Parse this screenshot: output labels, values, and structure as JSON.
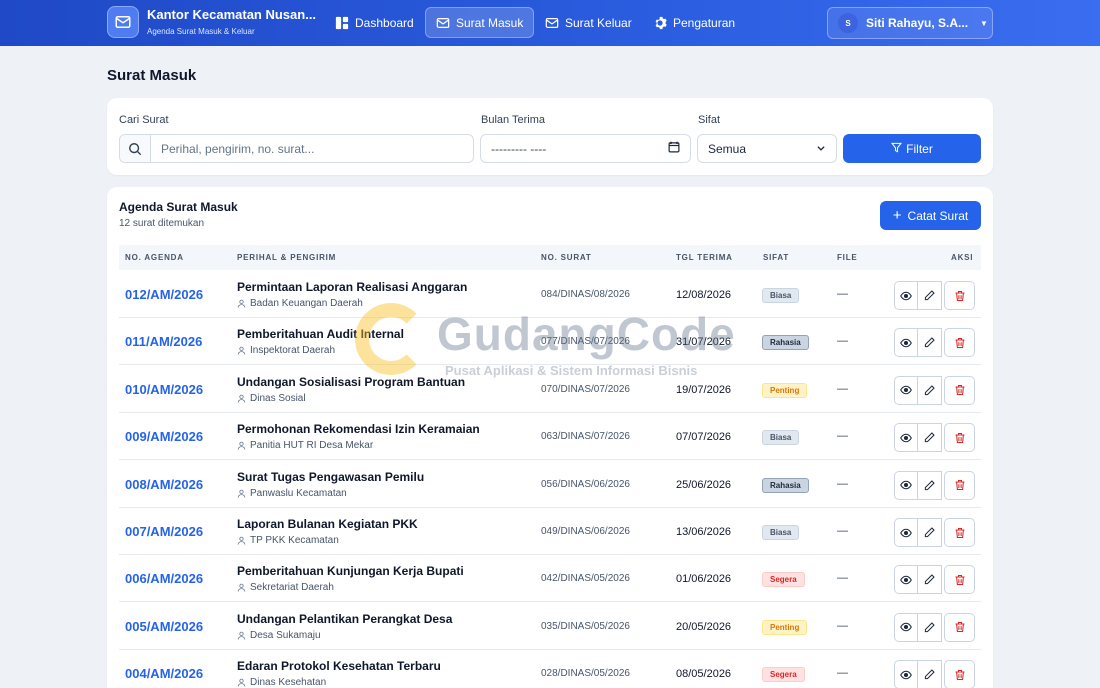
{
  "brand": {
    "title": "Kantor Kecamatan Nusan...",
    "subtitle": "Agenda Surat Masuk & Keluar"
  },
  "nav": {
    "items": [
      {
        "label": "Dashboard",
        "icon": "dashboard-icon"
      },
      {
        "label": "Surat Masuk",
        "icon": "inbox-mail-icon",
        "active": true
      },
      {
        "label": "Surat Keluar",
        "icon": "outbox-mail-icon"
      },
      {
        "label": "Pengaturan",
        "icon": "gear-icon"
      }
    ]
  },
  "user": {
    "initial": "S",
    "name": "Siti Rahayu, S.A..."
  },
  "page": {
    "title": "Surat Masuk"
  },
  "filters": {
    "search_label": "Cari Surat",
    "search_placeholder": "Perihal, pengirim, no. surat...",
    "month_label": "Bulan Terima",
    "month_value": "--------- ----",
    "sifat_label": "Sifat",
    "sifat_value": "Semua",
    "filter_button": "Filter"
  },
  "table": {
    "title": "Agenda Surat Masuk",
    "count_text": "12 surat ditemukan",
    "add_button": "Catat Surat",
    "headers": {
      "agenda": "NO. AGENDA",
      "perihal": "PERIHAL & PENGIRIM",
      "nosurat": "NO. SURAT",
      "tgl": "TGL TERIMA",
      "sifat": "SIFAT",
      "file": "FILE",
      "aksi": "AKSI"
    },
    "rows": [
      {
        "agenda": "012/AM/2026",
        "perihal": "Permintaan Laporan Realisasi Anggaran",
        "pengirim": "Badan Keuangan Daerah",
        "nosurat": "084/DINAS/08/2026",
        "tgl": "12/08/2026",
        "sifat": "Biasa",
        "file": "—"
      },
      {
        "agenda": "011/AM/2026",
        "perihal": "Pemberitahuan Audit Internal",
        "pengirim": "Inspektorat Daerah",
        "nosurat": "077/DINAS/07/2026",
        "tgl": "31/07/2026",
        "sifat": "Rahasia",
        "file": "—"
      },
      {
        "agenda": "010/AM/2026",
        "perihal": "Undangan Sosialisasi Program Bantuan",
        "pengirim": "Dinas Sosial",
        "nosurat": "070/DINAS/07/2026",
        "tgl": "19/07/2026",
        "sifat": "Penting",
        "file": "—"
      },
      {
        "agenda": "009/AM/2026",
        "perihal": "Permohonan Rekomendasi Izin Keramaian",
        "pengirim": "Panitia HUT RI Desa Mekar",
        "nosurat": "063/DINAS/07/2026",
        "tgl": "07/07/2026",
        "sifat": "Biasa",
        "file": "—"
      },
      {
        "agenda": "008/AM/2026",
        "perihal": "Surat Tugas Pengawasan Pemilu",
        "pengirim": "Panwaslu Kecamatan",
        "nosurat": "056/DINAS/06/2026",
        "tgl": "25/06/2026",
        "sifat": "Rahasia",
        "file": "—"
      },
      {
        "agenda": "007/AM/2026",
        "perihal": "Laporan Bulanan Kegiatan PKK",
        "pengirim": "TP PKK Kecamatan",
        "nosurat": "049/DINAS/06/2026",
        "tgl": "13/06/2026",
        "sifat": "Biasa",
        "file": "—"
      },
      {
        "agenda": "006/AM/2026",
        "perihal": "Pemberitahuan Kunjungan Kerja Bupati",
        "pengirim": "Sekretariat Daerah",
        "nosurat": "042/DINAS/05/2026",
        "tgl": "01/06/2026",
        "sifat": "Segera",
        "file": "—"
      },
      {
        "agenda": "005/AM/2026",
        "perihal": "Undangan Pelantikan Perangkat Desa",
        "pengirim": "Desa Sukamaju",
        "nosurat": "035/DINAS/05/2026",
        "tgl": "20/05/2026",
        "sifat": "Penting",
        "file": "—"
      },
      {
        "agenda": "004/AM/2026",
        "perihal": "Edaran Protokol Kesehatan Terbaru",
        "pengirim": "Dinas Kesehatan",
        "nosurat": "028/DINAS/05/2026",
        "tgl": "08/05/2026",
        "sifat": "Segera",
        "file": "—"
      }
    ]
  },
  "watermark": {
    "title": "GudangCode",
    "subtitle": "Pusat Aplikasi & Sistem Informasi Bisnis"
  },
  "colors": {
    "primary": "#2563eb",
    "navbar": "#2b5de0",
    "badge_biasa": "#e2e8f0",
    "badge_rahasia": "#cbd5e1",
    "badge_penting": "#fef3c7",
    "badge_segera": "#fee2e2"
  }
}
